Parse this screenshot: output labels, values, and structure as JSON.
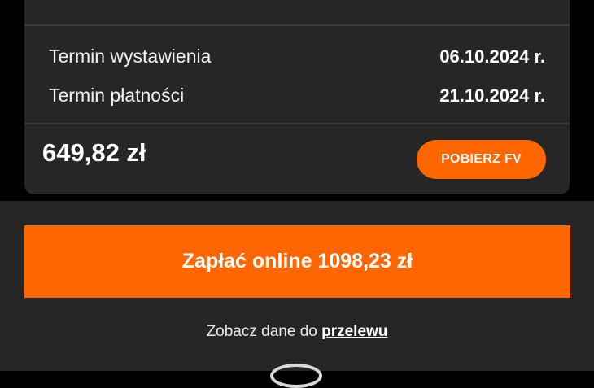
{
  "invoice": {
    "issue_label": "Termin wystawienia",
    "issue_value": "06.10.2024 r.",
    "due_label": "Termin płatności",
    "due_value": "21.10.2024 r.",
    "amount": "649,82 zł",
    "download_label": "POBIERZ FV"
  },
  "payment": {
    "pay_online_label": "Zapłać online 1098,23 zł",
    "transfer_prefix": "Zobacz dane do",
    "transfer_link": "przelewu"
  },
  "colors": {
    "accent": "#ff6600",
    "card": "#262626",
    "background": "#000000"
  }
}
